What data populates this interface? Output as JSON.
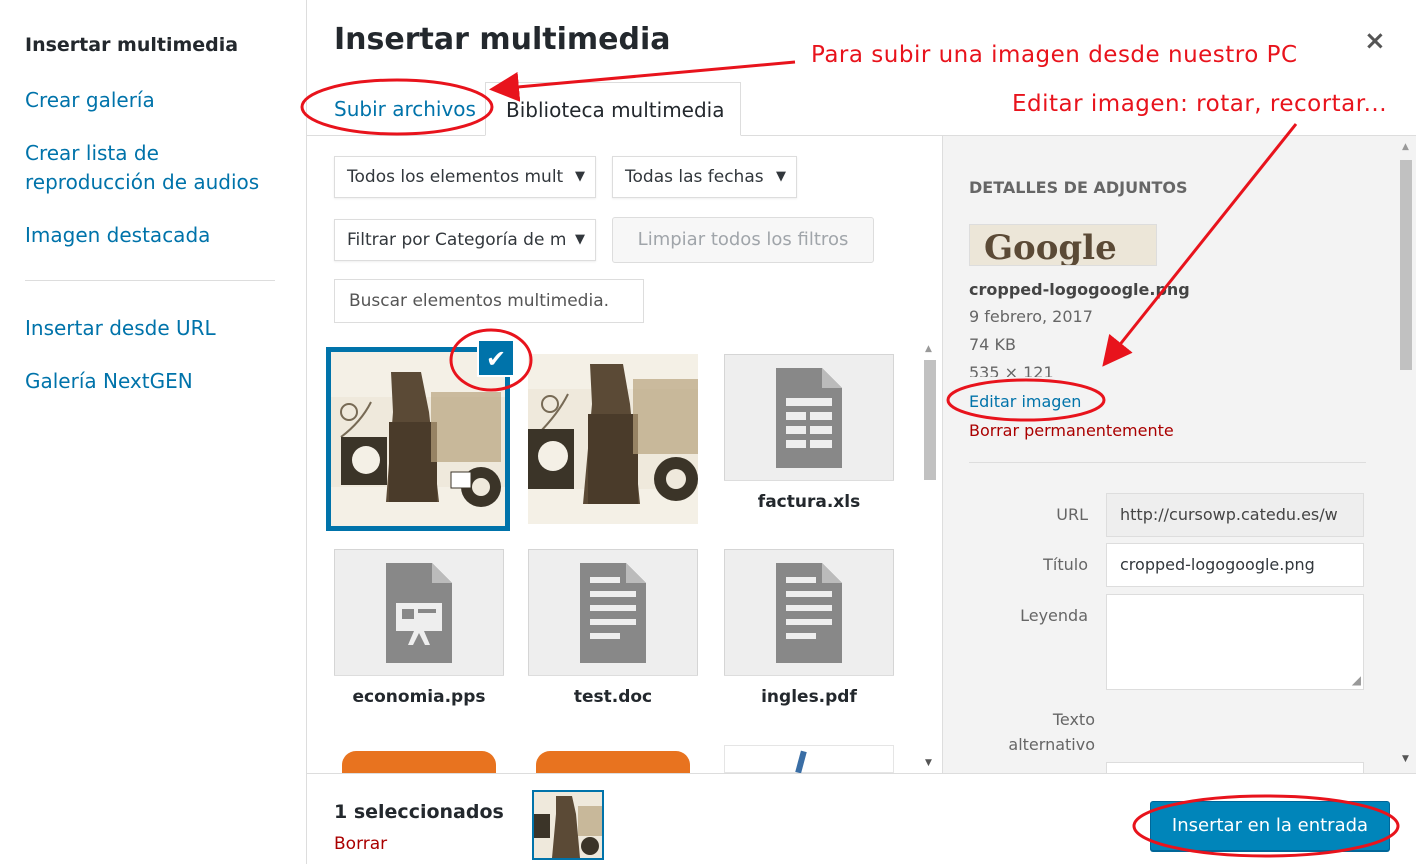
{
  "menu": {
    "items": [
      {
        "label": "Insertar multimedia",
        "active": true
      },
      {
        "label": "Crear galería"
      },
      {
        "label": "Crear lista de reproducción de audios",
        "line1": "Crear lista de",
        "line2": "reproducción de audios"
      },
      {
        "label": "Imagen destacada"
      },
      {
        "label": "Insertar desde URL"
      },
      {
        "label": "Galería NextGEN"
      }
    ]
  },
  "modal": {
    "title": "Insertar multimedia",
    "close_icon": "×"
  },
  "tabs": [
    {
      "label": "Subir archivos"
    },
    {
      "label": "Biblioteca multimedia",
      "active": true
    }
  ],
  "filters": {
    "type_select": "Todos los elementos mult",
    "date_select": "Todas las fechas",
    "category_select": "Filtrar por Categoría de m",
    "clear_button": "Limpiar todos los filtros",
    "search_placeholder": "Buscar elementos multimedia."
  },
  "attachments": [
    {
      "type": "image",
      "selected": true
    },
    {
      "type": "image"
    },
    {
      "type": "spreadsheet",
      "filename": "factura.xls"
    },
    {
      "type": "presentation",
      "filename": "economia.pps"
    },
    {
      "type": "document",
      "filename": "test.doc"
    },
    {
      "type": "document",
      "filename": "ingles.pdf"
    }
  ],
  "details": {
    "heading": "DETALLES DE ADJUNTOS",
    "thumb_text": "Google",
    "filename": "cropped-logogoogle.png",
    "date": "9 febrero, 2017",
    "size": "74 KB",
    "dimensions": "535 × 121",
    "edit_link": "Editar imagen",
    "delete_link": "Borrar permanentemente",
    "fields": {
      "url_label": "URL",
      "url_value": "http://cursowp.catedu.es/w",
      "title_label": "Título",
      "title_value": "cropped-logogoogle.png",
      "caption_label": "Leyenda",
      "alt_label_1": "Texto",
      "alt_label_2": "alternativo"
    }
  },
  "toolbar": {
    "selected_count": "1 seleccionados",
    "clear_label": "Borrar",
    "insert_button": "Insertar en la entrada"
  },
  "annotations": {
    "upload_note": "Para subir una imagen desde nuestro PC",
    "edit_note": "Editar imagen: rotar, recortar...",
    "color": "#e8131c"
  },
  "colors": {
    "accent": "#0073aa",
    "button": "#0085ba",
    "danger": "#a00"
  }
}
